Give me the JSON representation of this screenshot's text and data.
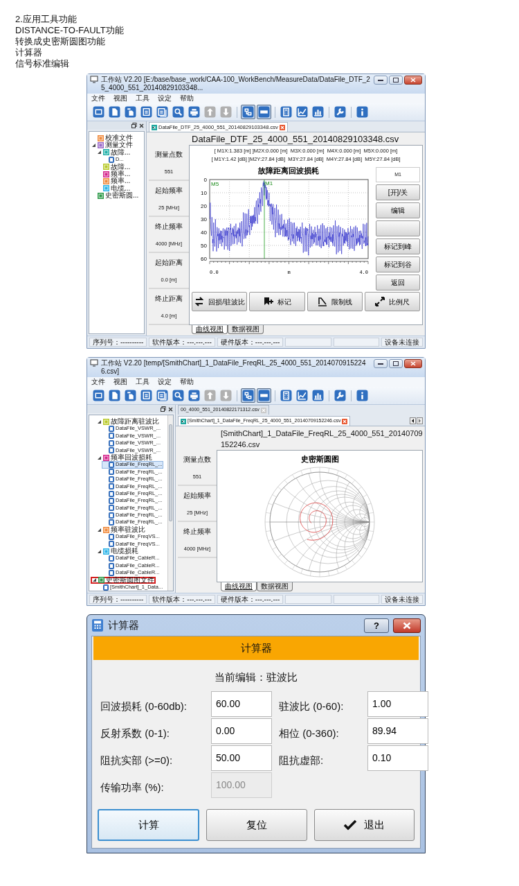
{
  "notes": [
    "2.应用工具功能",
    "DISTANCE-TO-FAULT功能",
    "转换成史密斯圆图功能",
    "计算器",
    "信号标准编辑"
  ],
  "windows": [
    {
      "title": "工作站 V2.20 [E:/base/base_work/CAA-100_WorkBench/MeasureData/DataFile_DTF_25_4000_551_20140829103348...",
      "menu": [
        "文件",
        "视图",
        "工具",
        "设定",
        "帮助"
      ],
      "toolbar": [
        [
          {
            "pressed": false,
            "disabled": false
          },
          {
            "pressed": false,
            "disabled": false
          },
          {
            "pressed": false,
            "disabled": false
          }
        ],
        [
          {
            "pressed": false,
            "disabled": false
          },
          {
            "pressed": false,
            "disabled": false
          }
        ],
        [
          {
            "pressed": false,
            "disabled": false
          },
          {
            "pressed": false,
            "disabled": false
          }
        ],
        [
          {
            "pressed": false,
            "disabled": true
          },
          {
            "pressed": false,
            "disabled": true
          }
        ],
        [
          {
            "pressed": true,
            "disabled": false
          },
          {
            "pressed": true,
            "disabled": false
          }
        ],
        [
          {
            "pressed": false,
            "disabled": false
          },
          {
            "pressed": false,
            "disabled": false
          },
          {
            "pressed": false,
            "disabled": false
          }
        ],
        [
          {
            "pressed": false,
            "disabled": false
          }
        ],
        [
          {
            "pressed": false,
            "disabled": false
          }
        ]
      ],
      "tree": {
        "scrollbar": false,
        "items": [
          {
            "label": "校准文件",
            "kind": "folder",
            "color": "#f08a3c",
            "selected": false
          },
          {
            "label": "测量文件",
            "kind": "folder",
            "color": "#9b6bc8",
            "expanded": true,
            "selected": false,
            "children": [
              {
                "label": "故障...",
                "kind": "folder",
                "color": "#20b0a8",
                "expanded": true,
                "selected": false,
                "children": [
                  {
                    "label": "D...",
                    "kind": "file",
                    "selected": false
                  }
                ]
              },
              {
                "label": "故障...",
                "kind": "folder",
                "color": "#b8c92a",
                "selected": false
              },
              {
                "label": "频率...",
                "kind": "folder",
                "color": "#d4258c",
                "selected": false
              },
              {
                "label": "频率...",
                "kind": "folder",
                "color": "#f08a3c",
                "selected": false
              },
              {
                "label": "电缆...",
                "kind": "folder",
                "color": "#2cb4e8",
                "selected": false
              }
            ]
          },
          {
            "label": "史密斯圆...",
            "kind": "folder",
            "color": "#2e9a4a",
            "selected": false
          }
        ]
      },
      "tabs": [
        {
          "label": "DataFile_DTF_25_4000_551_20140829103348.csv",
          "selected": true
        }
      ],
      "tab_scroll": false,
      "doc_title": "DataFile_DTF_25_4000_551_20140829103348.csv",
      "params": [
        {
          "label": "测量点数",
          "value": "551"
        },
        {
          "label": "起始频率",
          "value": "25 [MHz]"
        },
        {
          "label": "终止频率",
          "value": "4000 [MHz]"
        },
        {
          "label": "起始距离",
          "value": "0.0 [m]"
        },
        {
          "label": "终止距离",
          "value": "4.0 [m]"
        }
      ],
      "chart": {
        "kind": "dtf",
        "readouts": [
          "[ M1X:1.383 [m] ]M2X:0.000 [m]  M3X:0.000 [m]  M4X:0.000 [m]  M5X:0.000 [m]",
          "[ M1Y:1.42 [dB] ]M2Y:27.84 [dB]  M3Y:27.84 [dB]  M4Y:27.84 [dB]  M5Y:27.84 [dB]"
        ],
        "title": "故障距离回波损耗",
        "y_tick_labels": [
          "0",
          "10",
          "20",
          "30",
          "40",
          "50",
          "60"
        ],
        "x_labels": [
          "0.0",
          "m",
          "4.0"
        ],
        "markers": [
          "M5",
          "M1"
        ]
      },
      "side_buttons": [
        {
          "kind": "field",
          "value": "M1"
        },
        {
          "kind": "button",
          "label": "[开]/关"
        },
        {
          "kind": "button",
          "label": "编辑"
        },
        {
          "kind": "button"
        },
        {
          "kind": "button",
          "label": "标记到峰"
        },
        {
          "kind": "button",
          "label": "标记到谷"
        },
        {
          "kind": "button",
          "label": "返回"
        }
      ],
      "action_buttons": [
        {
          "label": "回损/驻波比"
        },
        {
          "label": "标记"
        },
        {
          "label": "限制线"
        },
        {
          "label": "比例尺"
        }
      ],
      "view_tabs": [
        {
          "label": "曲线视图",
          "selected": true
        },
        {
          "label": "数据视图",
          "selected": false
        }
      ],
      "status": [
        "序列号：----------",
        "软件版本：---.---.---",
        "硬件版本：---.---.---",
        "设备未连接"
      ]
    },
    {
      "title": "工作站 V2.20 [temp/[SmithChart]_1_DataFile_FreqRL_25_4000_551_20140709152246.csv]",
      "menu": [
        "文件",
        "视图",
        "工具",
        "设定",
        "帮助"
      ],
      "toolbar": [
        [
          {
            "pressed": false,
            "disabled": false
          },
          {
            "pressed": false,
            "disabled": false
          },
          {
            "pressed": false,
            "disabled": false
          }
        ],
        [
          {
            "pressed": false,
            "disabled": false
          },
          {
            "pressed": false,
            "disabled": false
          }
        ],
        [
          {
            "pressed": false,
            "disabled": false
          },
          {
            "pressed": false,
            "disabled": false
          }
        ],
        [
          {
            "pressed": false,
            "disabled": true
          },
          {
            "pressed": false,
            "disabled": true
          }
        ],
        [
          {
            "pressed": true,
            "disabled": false
          },
          {
            "pressed": true,
            "disabled": false
          }
        ],
        [
          {
            "pressed": false,
            "disabled": false
          },
          {
            "pressed": false,
            "disabled": false
          },
          {
            "pressed": false,
            "disabled": false
          }
        ],
        [
          {
            "pressed": false,
            "disabled": false
          }
        ],
        [
          {
            "pressed": false,
            "disabled": false
          }
        ]
      ],
      "tree": {
        "scrollbar": true,
        "items": [
          {
            "children": [
              {
                "label": "故障距离驻波比",
                "kind": "folder",
                "color": "#b8c92a",
                "expanded": true,
                "selected": false,
                "children": [
                  {
                    "label": "DataFile_VSWR_...",
                    "kind": "file",
                    "selected": false
                  },
                  {
                    "label": "DataFile_VSWR_...",
                    "kind": "file",
                    "selected": false
                  },
                  {
                    "label": "DataFile_VSWR_...",
                    "kind": "file",
                    "selected": false
                  },
                  {
                    "label": "DataFile_VSWR_...",
                    "kind": "file",
                    "selected": false
                  }
                ]
              },
              {
                "label": "频率回波损耗",
                "kind": "folder",
                "color": "#d4258c",
                "expanded": true,
                "selected": false,
                "children": [
                  {
                    "label": "DataFile_FreqRL_...",
                    "kind": "file",
                    "selected": true
                  },
                  {
                    "label": "DataFile_FreqRL_...",
                    "kind": "file",
                    "selected": false
                  },
                  {
                    "label": "DataFile_FreqRL_...",
                    "kind": "file",
                    "selected": false
                  },
                  {
                    "label": "DataFile_FreqRL_...",
                    "kind": "file",
                    "selected": false
                  },
                  {
                    "label": "DataFile_FreqRL_...",
                    "kind": "file",
                    "selected": false
                  },
                  {
                    "label": "DataFile_FreqRL_...",
                    "kind": "file",
                    "selected": false
                  },
                  {
                    "label": "DataFile_FreqRL_...",
                    "kind": "file",
                    "selected": false
                  },
                  {
                    "label": "DataFile_FreqRL_...",
                    "kind": "file",
                    "selected": false
                  },
                  {
                    "label": "DataFile_FreqRL_...",
                    "kind": "file",
                    "selected": false
                  }
                ]
              },
              {
                "label": "频率驻波比",
                "kind": "folder",
                "color": "#f08a3c",
                "expanded": true,
                "selected": false,
                "children": [
                  {
                    "label": "DataFile_FreqVS...",
                    "kind": "file",
                    "selected": false
                  },
                  {
                    "label": "DataFile_FreqVS...",
                    "kind": "file",
                    "selected": false
                  }
                ]
              },
              {
                "label": "电缆损耗",
                "kind": "folder",
                "color": "#2cb4e8",
                "expanded": true,
                "selected": false,
                "children": [
                  {
                    "label": "DataFile_CableR...",
                    "kind": "file",
                    "selected": false
                  },
                  {
                    "label": "DataFile_CableR...",
                    "kind": "file",
                    "selected": false
                  },
                  {
                    "label": "DataFile_CableR...",
                    "kind": "file",
                    "selected": false
                  }
                ]
              }
            ]
          },
          {
            "label": "史密斯圆图文件",
            "kind": "folder",
            "color": "#2e9a4a",
            "expanded": true,
            "selected": false,
            "highlighted": true,
            "children": [
              {
                "label": "[SmithChart]_1_Data...",
                "kind": "file",
                "selected": false
              }
            ]
          }
        ]
      },
      "tabs": [
        {
          "label": "00_4000_551_20140822171312.csv",
          "selected": false
        },
        {
          "label": "[SmithChart]_1_DataFile_FreqRL_25_4000_551_20140709152246.csv",
          "selected": true
        }
      ],
      "tab_scroll": true,
      "doc_title": "[SmithChart]_1_DataFile_FreqRL_25_4000_551_20140709152246.csv",
      "params": [
        {
          "label": "测量点数",
          "value": "551"
        },
        {
          "label": "起始频率",
          "value": "25 [MHz]"
        },
        {
          "label": "终止频率",
          "value": "4000 [MHz]"
        }
      ],
      "chart": {
        "kind": "smith",
        "title": "史密斯圆图"
      },
      "view_tabs": [
        {
          "label": "曲线视图",
          "selected": true
        },
        {
          "label": "数据视图",
          "selected": false
        }
      ],
      "status": [
        "序列号：----------",
        "软件版本：---.---.---",
        "硬件版本：---.---.---",
        "设备未连接"
      ]
    }
  ],
  "calculator": {
    "title": "计算器",
    "help": "?",
    "header": "计算器",
    "current": "当前编辑：驻波比",
    "fields": [
      {
        "label": "回波损耗 (0-60db):",
        "value": "60.00",
        "disabled": false
      },
      {
        "label": "驻波比 (0-60):",
        "value": "1.00",
        "disabled": false
      },
      {
        "label": "反射系数 (0-1):",
        "value": "0.00",
        "disabled": false
      },
      {
        "label": "相位 (0-360):",
        "value": "89.94",
        "disabled": false
      },
      {
        "label": "阻抗实部 (>=0):",
        "value": "50.00",
        "disabled": false
      },
      {
        "label": "阻抗虚部:",
        "value": "0.10",
        "disabled": false
      },
      {
        "label": "传输功率 (%):",
        "value": "100.00",
        "disabled": true
      }
    ],
    "buttons": [
      {
        "label": "计算",
        "selected": true
      },
      {
        "label": "复位",
        "selected": false
      },
      {
        "label": "退出",
        "selected": false
      }
    ]
  }
}
